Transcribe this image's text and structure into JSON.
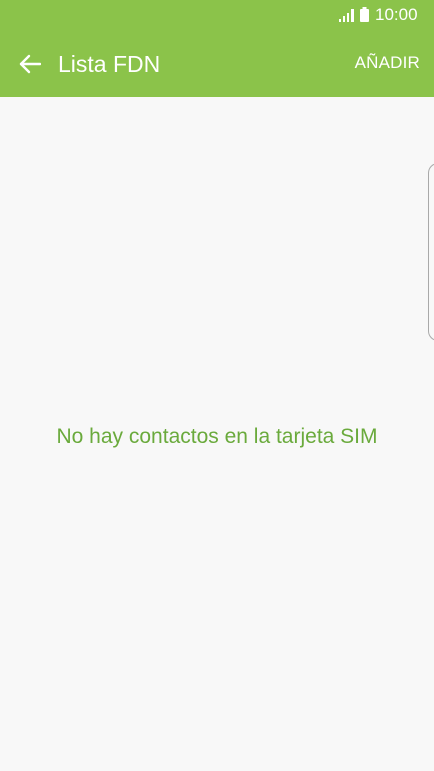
{
  "status_bar": {
    "time": "10:00",
    "icons": [
      "signal-icon",
      "battery-icon"
    ]
  },
  "app_bar": {
    "title": "Lista FDN",
    "action_label": "AÑADIR",
    "back_icon": "arrow-left-icon"
  },
  "content": {
    "empty_message": "No hay contactos en la tarjeta SIM"
  },
  "colors": {
    "accent": "#8bc34a",
    "message": "#6aaa3c",
    "background": "#f8f8f8"
  }
}
